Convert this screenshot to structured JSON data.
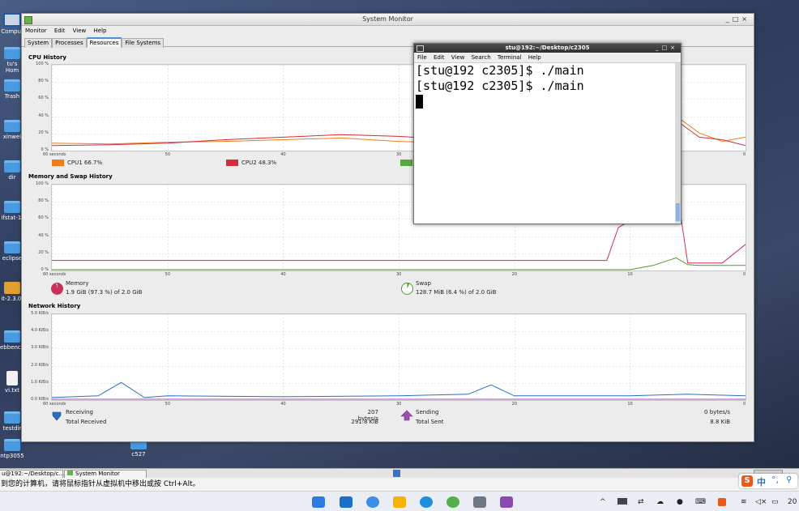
{
  "desktop_icons": [
    {
      "label": "Comput",
      "top": 16,
      "kind": "mon"
    },
    {
      "label": "tu's Hom",
      "top": 58,
      "kind": "folder"
    },
    {
      "label": "Trash",
      "top": 98,
      "kind": "folder"
    },
    {
      "label": "xinwei",
      "top": 148,
      "kind": "folder"
    },
    {
      "label": "dir",
      "top": 198,
      "kind": "folder"
    },
    {
      "label": "ifstat-1.",
      "top": 248,
      "kind": "folder"
    },
    {
      "label": "eclipse",
      "top": 298,
      "kind": "folder"
    },
    {
      "label": "it-2.3.0.",
      "top": 348,
      "kind": "pkg"
    },
    {
      "label": "ebbench",
      "top": 408,
      "kind": "folder"
    },
    {
      "label": "vi.txt",
      "top": 458,
      "kind": "file"
    },
    {
      "label": "testdir",
      "top": 508,
      "kind": "folder"
    },
    {
      "label": "ntp3055",
      "top": 542,
      "kind": "folder"
    }
  ],
  "c527_label": "c527",
  "sysmon": {
    "title": "System Monitor",
    "menu": [
      "Monitor",
      "Edit",
      "View",
      "Help"
    ],
    "tabs": [
      "System",
      "Processes",
      "Resources",
      "File Systems"
    ],
    "active_tab": "Resources",
    "cpu": {
      "title": "CPU History",
      "yticks": [
        "100 %",
        "80 %",
        "60 %",
        "40 %",
        "20 %",
        "0 %"
      ],
      "legend": [
        {
          "label": "CPU1 66.7%",
          "color": "#f07c1a"
        },
        {
          "label": "CPU2 48.3%",
          "color": "#d52b3a"
        },
        {
          "label": "",
          "color": "#58a840"
        }
      ]
    },
    "mem": {
      "title": "Memory and Swap History",
      "yticks": [
        "100 %",
        "80 %",
        "60 %",
        "40 %",
        "20 %",
        "0 %"
      ],
      "memory_label": "Memory",
      "memory_value": "1.9 GiB (97.3 %) of 2.0 GiB",
      "memory_color": "#c8315a",
      "memory_fraction": 0.973,
      "swap_label": "Swap",
      "swap_value": "128.7 MiB (6.4 %) of 2.0 GiB",
      "swap_color": "#4e9a2a",
      "swap_fraction": 0.064
    },
    "net": {
      "title": "Network History",
      "yticks": [
        "5.0 KiB/s",
        "4.0 KiB/s",
        "3.0 KiB/s",
        "2.0 KiB/s",
        "1.0 KiB/s",
        "0.0 KiB/s"
      ],
      "receiving_label": "Receiving",
      "receiving_rate": "207 bytes/s",
      "total_received_label": "Total Received",
      "total_received": "291.8 KiB",
      "sending_label": "Sending",
      "sending_rate": "0 bytes/s",
      "total_sent_label": "Total Sent",
      "total_sent": "8.8 KiB"
    },
    "xticks": [
      "60 seconds",
      "50",
      "40",
      "30",
      "20",
      "10",
      "0"
    ]
  },
  "terminal": {
    "title": "stu@192:~/Desktop/c2305",
    "menu": [
      "File",
      "Edit",
      "View",
      "Search",
      "Terminal",
      "Help"
    ],
    "lines": [
      "[stu@192 c2305]$ ./main",
      "[stu@192 c2305]$ ./main"
    ]
  },
  "panel": {
    "tasks": [
      "u@192:~/Desktop/c...",
      "System Monitor"
    ]
  },
  "notice": "到您的计算机，请将鼠标指针从虚拟机中移出或按 Ctrl+Alt。",
  "tray": {
    "ime": "中",
    "clock": "20"
  },
  "chart_data": [
    {
      "type": "line",
      "title": "CPU History",
      "x": [
        60,
        55,
        50,
        45,
        40,
        35,
        30,
        25,
        20,
        15,
        10,
        8,
        6,
        4,
        2,
        0
      ],
      "series": [
        {
          "name": "CPU1 66.7%",
          "values": [
            8,
            7,
            9,
            10,
            12,
            14,
            10,
            8,
            12,
            14,
            60,
            90,
            40,
            20,
            10,
            15
          ]
        },
        {
          "name": "CPU2 48.3%",
          "values": [
            5,
            6,
            8,
            12,
            15,
            18,
            16,
            12,
            10,
            12,
            40,
            95,
            35,
            15,
            12,
            5
          ]
        }
      ],
      "xlim": [
        60,
        0
      ],
      "ylim": [
        0,
        100
      ]
    },
    {
      "type": "line",
      "title": "Memory and Swap History",
      "x": [
        60,
        50,
        40,
        30,
        20,
        15,
        12,
        11,
        10,
        8,
        6,
        5,
        4,
        2,
        0
      ],
      "series": [
        {
          "name": "Memory",
          "values": [
            11,
            11,
            11,
            11,
            11,
            11,
            11,
            50,
            58,
            100,
            100,
            8,
            8,
            8,
            30
          ]
        },
        {
          "name": "Swap",
          "values": [
            0,
            0,
            0,
            0,
            0,
            0,
            0,
            0,
            0,
            5,
            14,
            6,
            5,
            5,
            5
          ]
        }
      ],
      "xlim": [
        60,
        0
      ],
      "ylim": [
        0,
        100
      ]
    },
    {
      "type": "line",
      "title": "Network History",
      "x": [
        60,
        56,
        54,
        52,
        50,
        40,
        30,
        24,
        22,
        20,
        10,
        5,
        0
      ],
      "series": [
        {
          "name": "Receiving",
          "values": [
            0.1,
            0.2,
            1.0,
            0.1,
            0.2,
            0.15,
            0.2,
            0.3,
            0.85,
            0.2,
            0.2,
            0.3,
            0.2
          ]
        },
        {
          "name": "Sending",
          "values": [
            0,
            0,
            0,
            0,
            0,
            0,
            0,
            0,
            0,
            0,
            0,
            0,
            0
          ]
        }
      ],
      "xlim": [
        60,
        0
      ],
      "ylim": [
        0,
        5
      ]
    }
  ]
}
